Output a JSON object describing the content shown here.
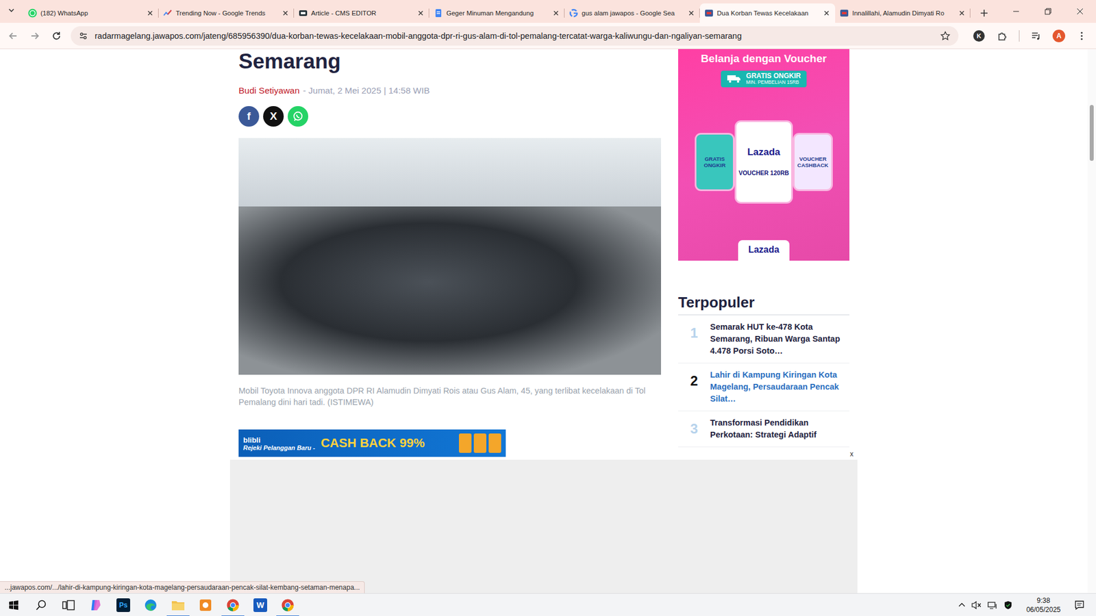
{
  "browser": {
    "tabs": [
      {
        "label": "(182) WhatsApp",
        "kind": "whatsapp",
        "selected": false
      },
      {
        "label": "Trending Now - Google Trends",
        "kind": "trends",
        "selected": false
      },
      {
        "label": "Article - CMS EDITOR",
        "kind": "cms",
        "selected": false
      },
      {
        "label": "Geger Minuman Mengandung",
        "kind": "doc",
        "selected": false
      },
      {
        "label": "gus alam jawapos - Google Sea",
        "kind": "google",
        "selected": false
      },
      {
        "label": "Dua Korban Tewas Kecelakaan",
        "kind": "site",
        "selected": true
      },
      {
        "label": "Innalillahi, Alamudin Dimyati Ro",
        "kind": "site",
        "selected": false
      }
    ],
    "url": "radarmagelang.jawapos.com/jateng/685956390/dua-korban-tewas-kecelakaan-mobil-anggota-dpr-ri-gus-alam-di-tol-pemalang-tercatat-warga-kaliwungu-dan-ngaliyan-semarang",
    "extension_label": "K",
    "profile_initial": "A",
    "status_link": "...jawapos.com/.../lahir-di-kampung-kiringan-kota-magelang-persaudaraan-pencak-silat-kembang-setaman-menapa..."
  },
  "article": {
    "title": "Semarang",
    "author": "Budi Setiyawan",
    "date": "- Jumat, 2 Mei 2025 | 14:58 WIB",
    "share": [
      {
        "kind": "facebook",
        "glyph": "f",
        "color": "#3b5998"
      },
      {
        "kind": "x",
        "glyph": "X",
        "color": "#111111"
      },
      {
        "kind": "whatsapp",
        "glyph": "",
        "color": "#25d366"
      }
    ],
    "caption": "Mobil Toyota Innova anggota DPR RI Alamudin Dimyati Rois atau Gus Alam, 45, yang terlibat kecelakaan di Tol Pemalang dini hari tadi. (ISTIMEWA)",
    "banner": {
      "brand": "blibli",
      "tagline": "Rejeki Pelanggan Baru -",
      "offer": "CASH BACK 99%"
    }
  },
  "sidebar": {
    "ad": {
      "headline": "Belanja dengan Voucher",
      "badge": "GRATIS ONGKIR",
      "badge_note": "MIN. PEMBELIAN 15RB",
      "cards": [
        {
          "kind": "side",
          "text": "GRATIS ONGKIR",
          "color": "#39c6bd"
        },
        {
          "kind": "main",
          "brand": "Lazada",
          "text": "VOUCHER 120RB",
          "color": "#ffffff"
        },
        {
          "kind": "side",
          "text": "VOUCHER CASHBACK",
          "color": "#f3e7ff"
        }
      ],
      "footer_brand": "Lazada"
    },
    "popular_title": "Terpopuler",
    "popular": [
      {
        "rank": "1",
        "title": "Semarak HUT ke-478 Kota Semarang, Ribuan Warga Santap 4.478 Porsi Soto…",
        "hovered": false
      },
      {
        "rank": "2",
        "title": "Lahir di Kampung Kiringan Kota Magelang, Persaudaraan Pencak Silat…",
        "hovered": true
      },
      {
        "rank": "3",
        "title": "Transformasi Pendidikan Perkotaan: Strategi Adaptif",
        "hovered": false
      }
    ]
  },
  "overlay_ad": {
    "close": "x"
  },
  "taskbar": {
    "apps": [
      {
        "kind": "copilot",
        "active": false
      },
      {
        "kind": "photoshop",
        "label": "Ps",
        "active": false
      },
      {
        "kind": "edge",
        "active": false
      },
      {
        "kind": "explorer",
        "active": true
      },
      {
        "kind": "orange",
        "active": false
      },
      {
        "kind": "chrome",
        "active": true
      },
      {
        "kind": "word",
        "label": "W",
        "active": false
      },
      {
        "kind": "chrome",
        "active": true
      }
    ],
    "time": "9:38",
    "date": "06/05/2025"
  }
}
